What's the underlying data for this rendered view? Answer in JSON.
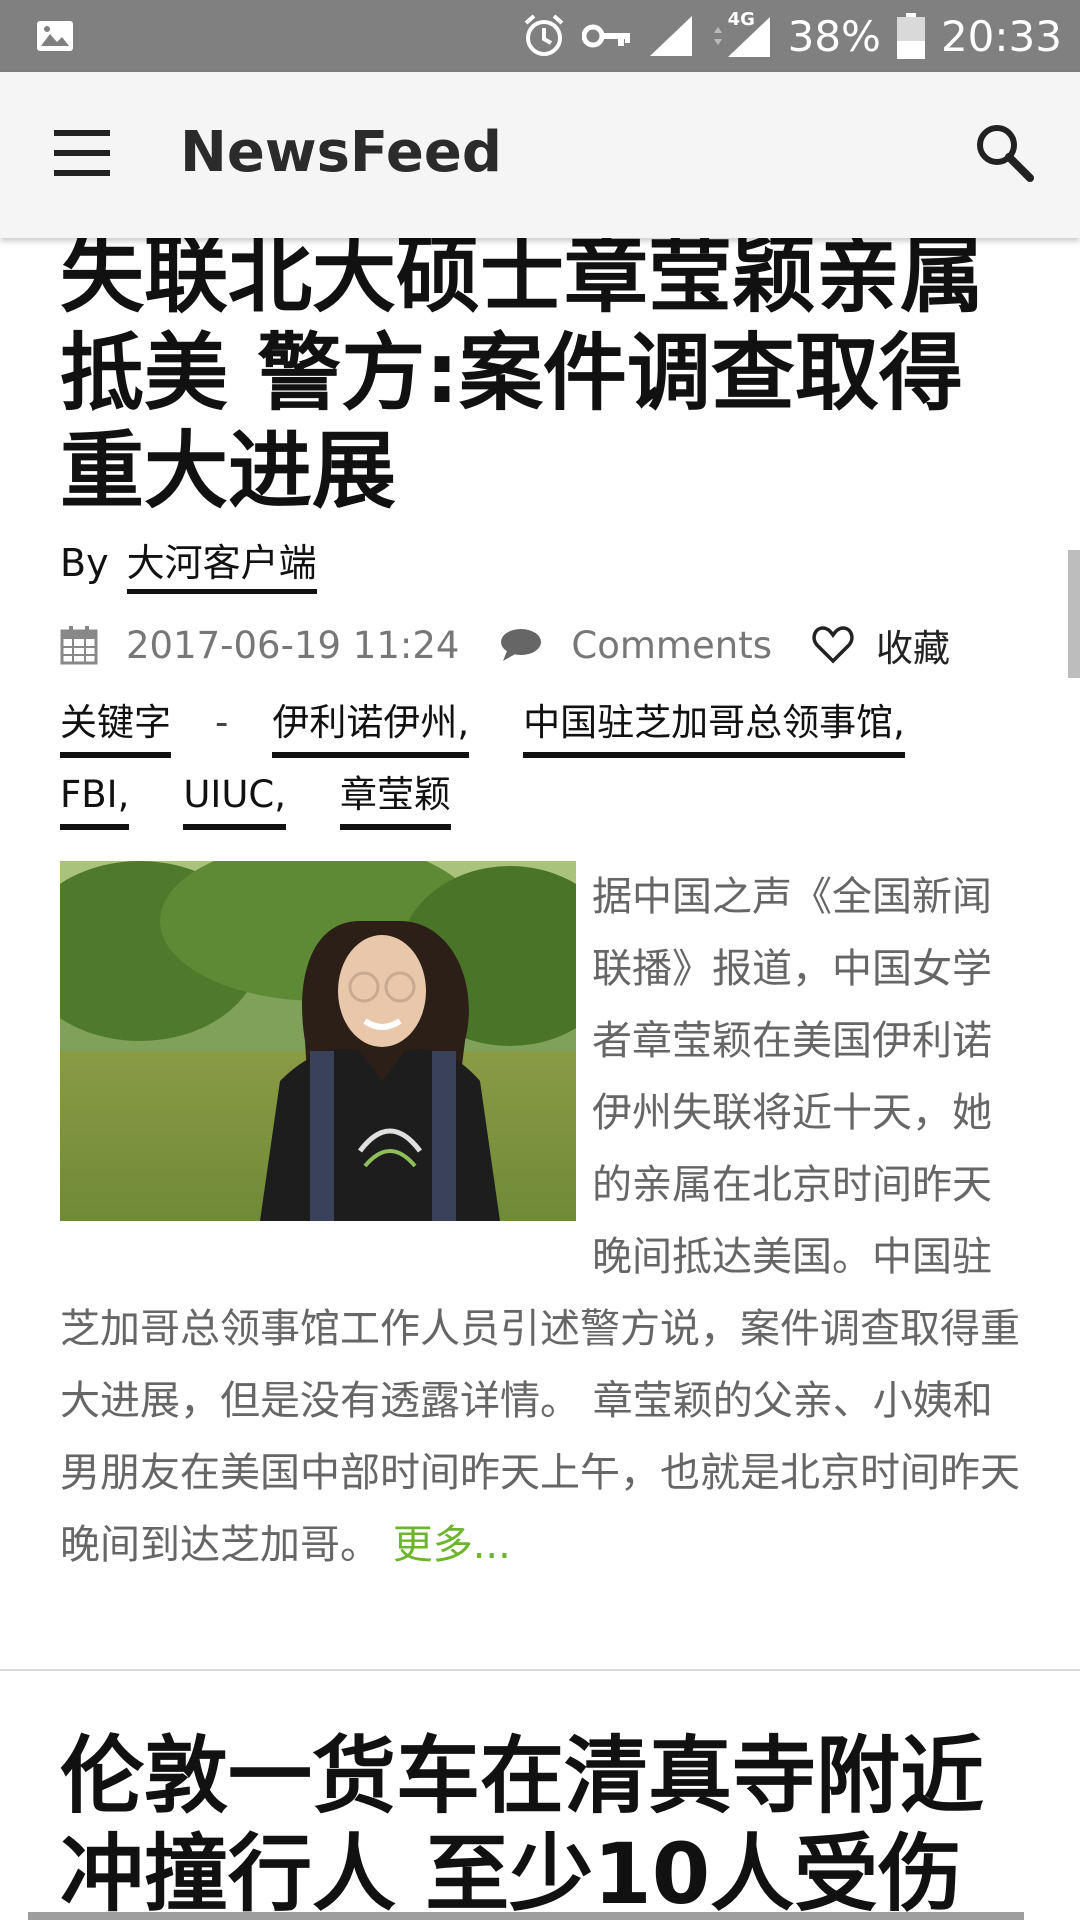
{
  "status_bar": {
    "battery_percent": "38%",
    "time": "20:33",
    "network": "4G"
  },
  "app_bar": {
    "title": "NewsFeed"
  },
  "article": {
    "headline": "失联北大硕士章莹颖亲属抵美 警方:案件调查取得重大进展",
    "byline_prefix": "By",
    "author": "大河客户端",
    "date": "2017-06-19 11:24",
    "comments_label": "Comments",
    "favorite_label": "收藏",
    "keywords_label": "关键字",
    "keywords_sep": "-",
    "tags": [
      "伊利诺伊州,",
      "中国驻芝加哥总领事馆,",
      "FBI,",
      "UIUC,",
      "章莹颖"
    ],
    "body": "据中国之声《全国新闻联播》报道，中国女学者章莹颖在美国伊利诺伊州失联将近十天，她的亲属在北京时间昨天晚间抵达美国。中国驻芝加哥总领事馆工作人员引述警方说，案件调查取得重大进展，但是没有透露详情。 章莹颖的父亲、小姨和男朋友在美国中部时间昨天上午，也就是北京时间昨天晚间到达芝加哥。",
    "more_label": "更多..."
  },
  "next_article": {
    "headline": "伦敦一货车在清真寺附近冲撞行人 至少10人受伤"
  },
  "colors": {
    "status_bar": "#808080",
    "app_bar": "#f5f5f5",
    "more_link": "#6cb52d",
    "body_text": "#666666"
  }
}
